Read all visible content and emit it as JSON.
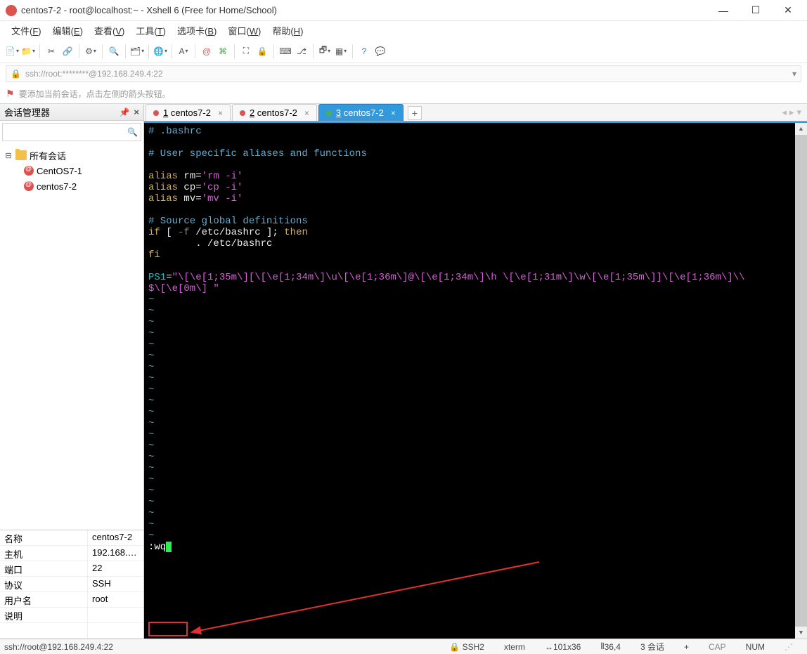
{
  "window": {
    "title": "centos7-2 - root@localhost:~ - Xshell 6 (Free for Home/School)"
  },
  "menu": [
    "文件(F)",
    "编辑(E)",
    "查看(V)",
    "工具(T)",
    "选项卡(B)",
    "窗口(W)",
    "帮助(H)"
  ],
  "toolbar_icons": [
    "new-session",
    "open",
    "sep",
    "copy",
    "paste",
    "sep",
    "properties",
    "sep",
    "find",
    "sep",
    "sessions",
    "sep",
    "globe",
    "sep",
    "font",
    "sep",
    "swirl",
    "command",
    "sep",
    "fullscreen",
    "lock",
    "sep",
    "keyboard",
    "branch",
    "sep",
    "new-window",
    "layout",
    "sep",
    "help",
    "speech"
  ],
  "addressbar": {
    "text": "ssh://root:********@192.168.249.4:22"
  },
  "hint": "要添加当前会话，点击左侧的箭头按钮。",
  "sidebar": {
    "title": "会话管理器",
    "root": "所有会话",
    "items": [
      "CentOS7-1",
      "centos7-2"
    ]
  },
  "properties": [
    {
      "key": "名称",
      "val": "centos7-2"
    },
    {
      "key": "主机",
      "val": "192.168.2..."
    },
    {
      "key": "端口",
      "val": "22"
    },
    {
      "key": "协议",
      "val": "SSH"
    },
    {
      "key": "用户名",
      "val": "root"
    },
    {
      "key": "说明",
      "val": ""
    }
  ],
  "tabs": [
    {
      "num": "1",
      "label": "centos7-2",
      "status": "red"
    },
    {
      "num": "2",
      "label": "centos7-2",
      "status": "red"
    },
    {
      "num": "3",
      "label": "centos7-2",
      "status": "green",
      "active": true
    }
  ],
  "terminal": {
    "lines": [
      {
        "text": "# .bashrc",
        "cls": "tcomment"
      },
      {
        "text": ""
      },
      {
        "text": "# User specific aliases and functions",
        "cls": "tcomment"
      },
      {
        "text": ""
      },
      {
        "segs": [
          {
            "t": "alias",
            "c": "tyellow"
          },
          {
            "t": " rm=",
            "c": "twhite"
          },
          {
            "t": "'rm -i'",
            "c": "tpink"
          }
        ]
      },
      {
        "segs": [
          {
            "t": "alias",
            "c": "tyellow"
          },
          {
            "t": " cp=",
            "c": "twhite"
          },
          {
            "t": "'cp -i'",
            "c": "tpink"
          }
        ]
      },
      {
        "segs": [
          {
            "t": "alias",
            "c": "tyellow"
          },
          {
            "t": " mv=",
            "c": "twhite"
          },
          {
            "t": "'mv -i'",
            "c": "tpink"
          }
        ]
      },
      {
        "text": ""
      },
      {
        "text": "# Source global definitions",
        "cls": "tcomment"
      },
      {
        "segs": [
          {
            "t": "if",
            "c": "tyellow"
          },
          {
            "t": " [ ",
            "c": "twhite"
          },
          {
            "t": "-f",
            "c": "tgrey"
          },
          {
            "t": " /etc/bashrc ]; ",
            "c": "twhite"
          },
          {
            "t": "then",
            "c": "tyellow"
          }
        ]
      },
      {
        "text": "        . /etc/bashrc",
        "cls": "twhite"
      },
      {
        "segs": [
          {
            "t": "fi",
            "c": "tyellow"
          }
        ]
      },
      {
        "text": ""
      },
      {
        "segs": [
          {
            "t": "PS1",
            "c": "tcyan"
          },
          {
            "t": "=",
            "c": "twhite"
          },
          {
            "t": "\"\\[\\e[1;35m\\][\\[\\e[1;34m\\]\\u\\[\\e[1;36m\\]@\\[\\e[1;34m\\]\\h \\[\\e[1;31m\\]\\w\\[\\e[1;35m\\]]\\[\\e[1;36m\\]\\\\",
            "c": "tpink"
          }
        ]
      },
      {
        "segs": [
          {
            "t": "$\\[\\e[0m\\] \"",
            "c": "tpink"
          }
        ]
      }
    ],
    "tilde_count": 22,
    "command": ":wq"
  },
  "status": {
    "left": "ssh://root@192.168.249.4:22",
    "ssh": "SSH2",
    "term": "xterm",
    "size": "101x36",
    "pos": "36,4",
    "sessions": "3 会话",
    "cap": "CAP",
    "num": "NUM"
  }
}
